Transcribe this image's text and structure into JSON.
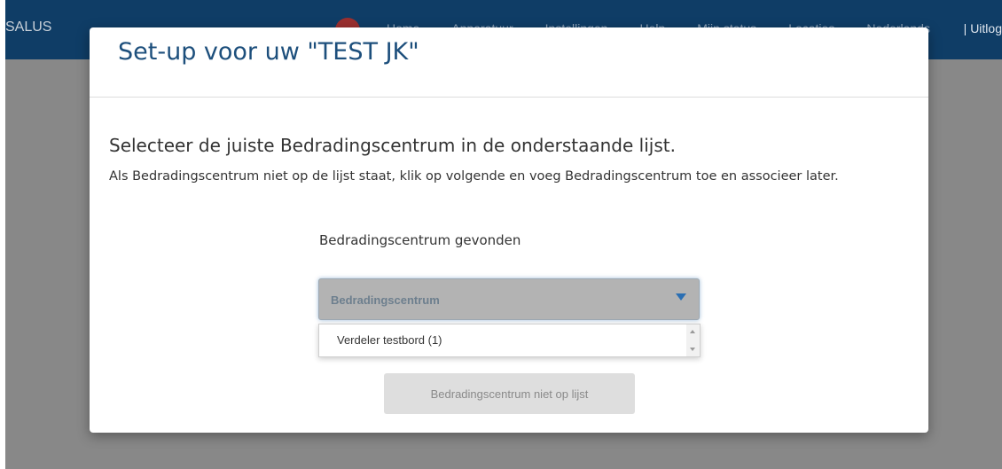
{
  "app": {
    "brand": "SALUS",
    "nav": [
      "Home",
      "Apparatuur",
      "Instellingen",
      "Help",
      "Mijn status",
      "Locaties",
      "Nederlands"
    ],
    "logout": "| Uitlog"
  },
  "modal": {
    "title": "Set-up voor uw \"TEST JK\"",
    "heading": "Selecteer de juiste Bedradingscentrum in de onderstaande lijst.",
    "text": "Als Bedradingscentrum niet op de lijst staat, klik op volgende en voeg Bedradingscentrum toe en associeer later.",
    "found_label": "Bedradingscentrum gevonden",
    "select": {
      "placeholder": "Bedradingscentrum",
      "options": [
        "Verdeler testbord (1)"
      ]
    },
    "not_listed_button": "Bedradingscentrum niet op lijst"
  },
  "colors": {
    "navbar": "#0f3d66",
    "title": "#1d4f7c",
    "accent": "#2b6fb3",
    "badge": "#9b2f2f"
  }
}
